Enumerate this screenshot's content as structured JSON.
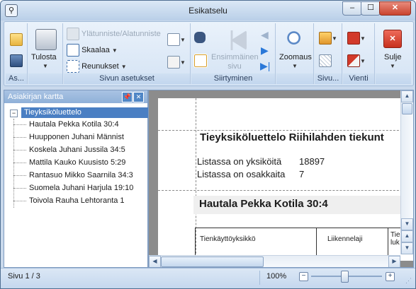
{
  "window": {
    "title": "Esikatselu",
    "min_glyph": "–",
    "max_glyph": "☐",
    "close_glyph": "✕"
  },
  "ribbon": {
    "groups": {
      "file": "As...",
      "print": "",
      "page_setup": "Sivun asetukset",
      "navigation": "Siirtyminen",
      "zoom": "",
      "page_bg": "Sivu...",
      "export": "Vienti",
      "close": ""
    },
    "print_label": "Tulosta",
    "header_footer_label": "Ylätunniste/Alatunniste",
    "scale_label": "Skaalaa",
    "margins_label": "Reunukset",
    "first_page_label": "Ensimmäinen sivu",
    "zoom_label": "Zoomaus",
    "close_label": "Sulje"
  },
  "doc_map": {
    "title": "Asiakirjan kartta",
    "root": "Tieyksiköluettelo",
    "items": [
      "Hautala Pekka  Kotila 30:4",
      "Huupponen Juhani  Männist",
      "Koskela Juhani  Jussila 34:5",
      "Mattila Kauko  Kuusisto 5:29",
      "Rantasuo Mikko  Saarnila 34:3",
      "Suomela Juhani  Harjula 19:10",
      "Toivola Rauha  Lehtoranta 1"
    ]
  },
  "preview": {
    "report_title": "Tieyksiköluettelo  Riihilahden tiekunt",
    "rows": [
      {
        "label": "Listassa on yksiköitä",
        "value": "18897"
      },
      {
        "label": "Listassa on osakkaita",
        "value": "7"
      }
    ],
    "section_title": "Hautala Pekka   Kotila 30:4",
    "table_headers": [
      "Tienkäyttöyksikkö",
      "Liikennelaji",
      "Tie"
    ],
    "table_header_extra": "luk"
  },
  "status": {
    "page": "Sivu 1 / 3",
    "zoom": "100%",
    "zoom_level_fraction": 0.5
  },
  "colors": {
    "selection": "#4a7fc3",
    "close_button": "#c9432e",
    "pdf_red": "#d23a2a"
  }
}
